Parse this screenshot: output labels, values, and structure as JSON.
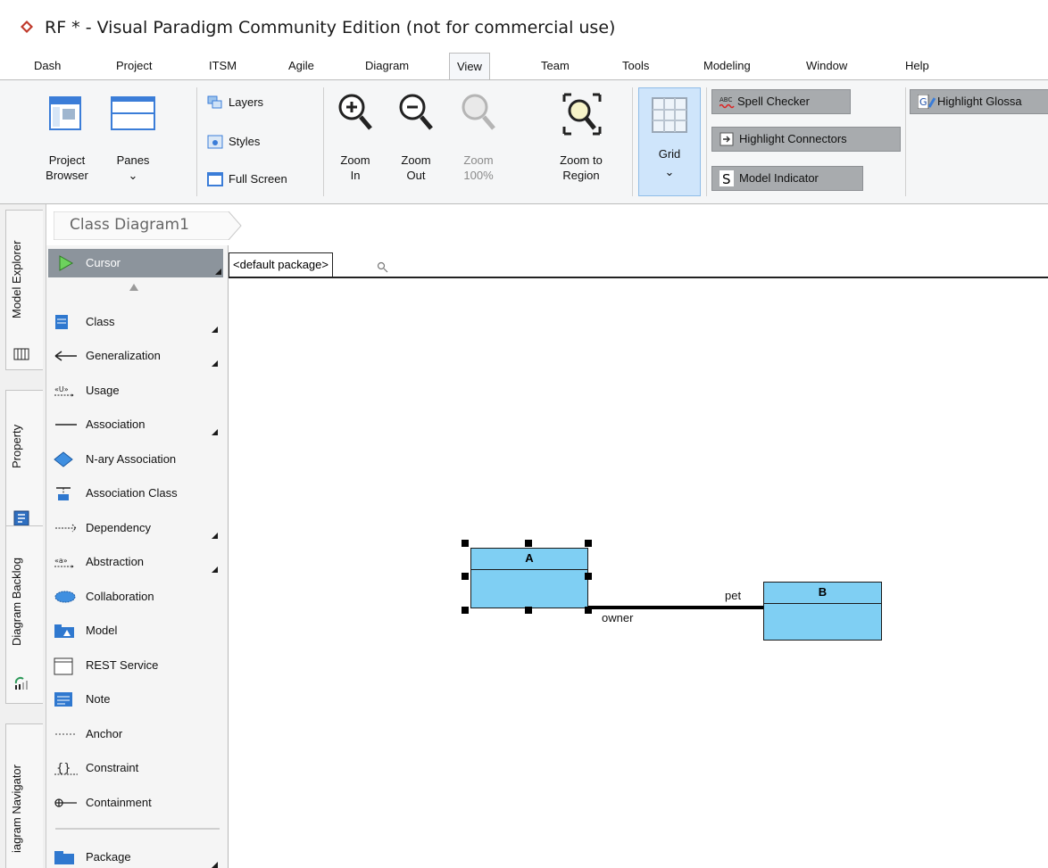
{
  "window": {
    "title": "RF * - Visual Paradigm Community Edition (not for commercial use)"
  },
  "menu": {
    "tabs": [
      "Dash",
      "Project",
      "ITSM",
      "Agile",
      "Diagram",
      "View",
      "Team",
      "Tools",
      "Modeling",
      "Window",
      "Help"
    ],
    "active": "View"
  },
  "ribbon": {
    "project_browser": {
      "line1": "Project",
      "line2": "Browser"
    },
    "panes": {
      "line1": "Panes",
      "line2": "⌄"
    },
    "layers": "Layers",
    "styles": "Styles",
    "full_screen": "Full Screen",
    "zoom_in": {
      "line1": "Zoom",
      "line2": "In"
    },
    "zoom_out": {
      "line1": "Zoom",
      "line2": "Out"
    },
    "zoom_100": {
      "line1": "Zoom",
      "line2": "100%"
    },
    "zoom_to_region": {
      "line1": "Zoom to",
      "line2": "Region"
    },
    "grid": {
      "line1": "Grid",
      "line2": "⌄"
    },
    "spell_checker": "Spell Checker",
    "highlight_connectors": "Highlight Connectors",
    "model_indicator": "Model Indicator",
    "highlight_glossary": "Highlight Glossa"
  },
  "side_tabs": [
    "Model Explorer",
    "Property",
    "Diagram Backlog",
    "iagram Navigator"
  ],
  "breadcrumb": {
    "diagram": "Class Diagram1"
  },
  "package_bar": {
    "package": "<default package>"
  },
  "palette": {
    "items": [
      {
        "label": "Cursor",
        "selected": true
      },
      {
        "label": "Class"
      },
      {
        "label": "Generalization"
      },
      {
        "label": "Usage"
      },
      {
        "label": "Association"
      },
      {
        "label": "N-ary Association"
      },
      {
        "label": "Association Class"
      },
      {
        "label": "Dependency"
      },
      {
        "label": "Abstraction"
      },
      {
        "label": "Collaboration"
      },
      {
        "label": "Model"
      },
      {
        "label": "REST Service"
      },
      {
        "label": "Note"
      },
      {
        "label": "Anchor"
      },
      {
        "label": "Constraint"
      },
      {
        "label": "Containment"
      },
      {
        "label": "Package"
      }
    ]
  },
  "diagram": {
    "class_a": "A",
    "class_b": "B",
    "role_owner": "owner",
    "role_pet": "pet"
  },
  "colors": {
    "class_fill": "#7fcff3",
    "accent": "#3b7dd8"
  }
}
